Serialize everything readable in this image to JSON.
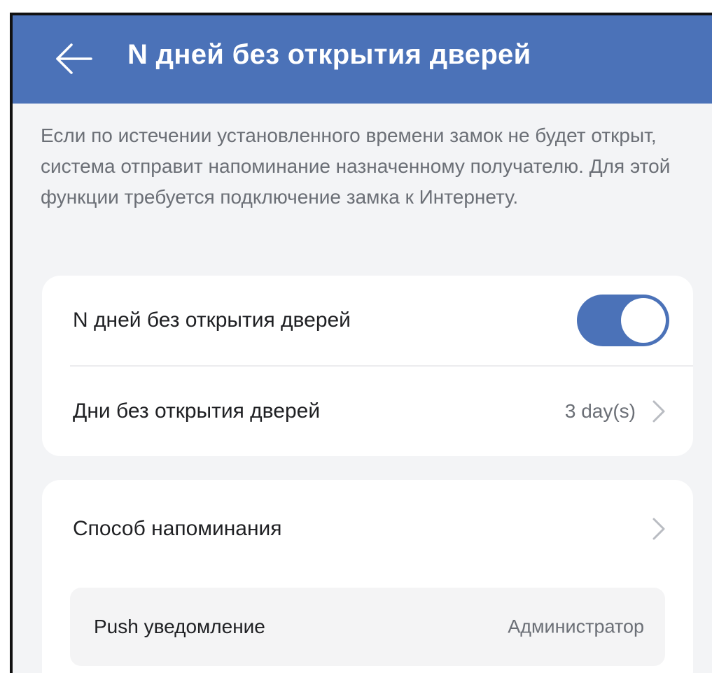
{
  "header": {
    "title": "N дней без открытия дверей",
    "back_icon": "arrow-left-icon"
  },
  "description": "Если по истечении установленного времени замок не будет открыт, система отправит напоминание назначенному получателю. Для этой функции требуется подключение замка к Интернету.",
  "settings": {
    "toggle_row": {
      "label": "N дней без открытия дверей",
      "enabled": true
    },
    "days_row": {
      "label": "Дни без открытия дверей",
      "value": "3 day(s)",
      "icon": "chevron-right-icon"
    }
  },
  "reminder": {
    "method_row": {
      "label": "Способ напоминания",
      "icon": "chevron-right-icon"
    },
    "push_row": {
      "label": "Push уведомление",
      "value": "Администратор"
    }
  },
  "colors": {
    "accent": "#4b72b8",
    "background": "#f3f4f6",
    "card": "#ffffff",
    "secondary_text": "#6b6f76"
  }
}
